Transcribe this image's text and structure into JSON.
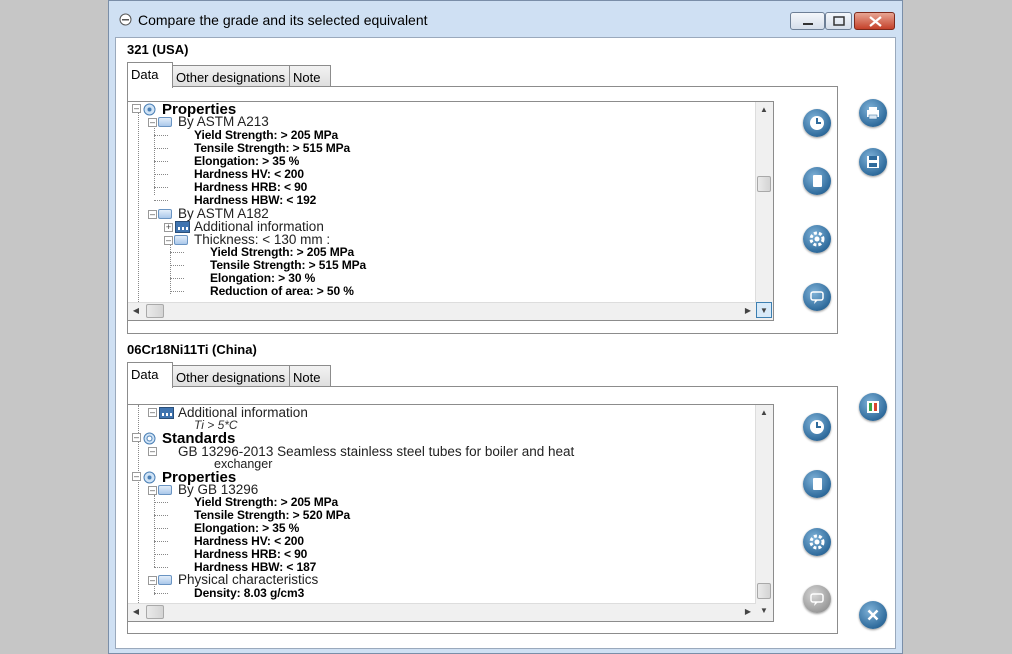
{
  "window": {
    "title": "Compare the grade and its selected equivalent"
  },
  "top": {
    "grade": "321 (USA)",
    "tabs": [
      "Data",
      "Other designations",
      "Note"
    ],
    "tree": {
      "properties": "Properties",
      "by_astm_a213": "By ASTM A213",
      "a213_props": [
        "Yield Strength: > 205 MPa",
        "Tensile Strength: > 515 MPa",
        "Elongation: > 35 %",
        "Hardness HV: < 200",
        "Hardness HRB: < 90",
        "Hardness HBW: < 192"
      ],
      "by_astm_a182": "By ASTM A182",
      "additional_info": "Additional information",
      "thickness": "Thickness: < 130 mm :",
      "thickness_props": [
        "Yield Strength: > 205 MPa",
        "Tensile Strength: > 515 MPa",
        "Elongation: > 30 %",
        "Reduction of area: > 50 %"
      ]
    }
  },
  "bottom": {
    "grade": "06Cr18Ni11Ti (China)",
    "tabs": [
      "Data",
      "Other designations",
      "Note"
    ],
    "tree": {
      "additional_info": "Additional information",
      "ti_note": "Ti > 5*C",
      "standards": "Standards",
      "standard_line1": "GB 13296-2013 Seamless stainless steel tubes for boiler and heat",
      "standard_line2": "exchanger",
      "properties": "Properties",
      "by_gb": "By GB 13296",
      "gb_props": [
        "Yield Strength: > 205 MPa",
        "Tensile Strength: > 520 MPa",
        "Elongation: > 35 %",
        "Hardness HV: < 200",
        "Hardness HRB: < 90",
        "Hardness HBW: < 187"
      ],
      "physical": "Physical characteristics",
      "density": "Density: 8.03 g/cm3"
    }
  },
  "icons": {
    "side_top": [
      "clock-icon",
      "copy-icon",
      "gear-icon",
      "comment-icon"
    ],
    "side_bottom": [
      "clock-icon",
      "copy-icon",
      "gear-icon",
      "comment-icon"
    ],
    "right": [
      "print-icon",
      "save-icon",
      "compare-icon",
      "close-icon"
    ]
  },
  "colors": {
    "accent": "#2f6b9c",
    "window_frame": "#cfe0f3",
    "background": "#c6c6c6"
  }
}
